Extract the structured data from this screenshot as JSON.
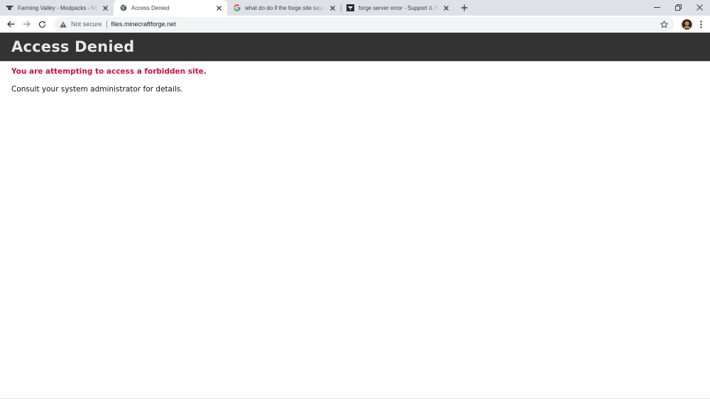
{
  "browser": {
    "tabs": [
      {
        "title": "Farming Valley - Modpacks - Minecraft",
        "favicon": "curseforge-anvil-icon",
        "active": false
      },
      {
        "title": "Access Denied",
        "favicon": "globe-icon",
        "active": true
      },
      {
        "title": "what do do if the forge site says access denied",
        "favicon": "google-g-icon",
        "active": false
      },
      {
        "title": "forge server error - Support & Bug Reports",
        "favicon": "forge-flag-icon",
        "active": false
      }
    ],
    "address_bar": {
      "security_label": "Not secure",
      "url": "files.minecraftforge.net"
    }
  },
  "page": {
    "heading": "Access Denied",
    "error_message": "You are attempting to access a forbidden site.",
    "detail_message": "Consult your system administrator for details."
  },
  "colors": {
    "header_bg": "#333333",
    "header_text": "#e8e8e8",
    "error_text": "#d0103a",
    "tabstrip_bg": "#dee1e6"
  }
}
